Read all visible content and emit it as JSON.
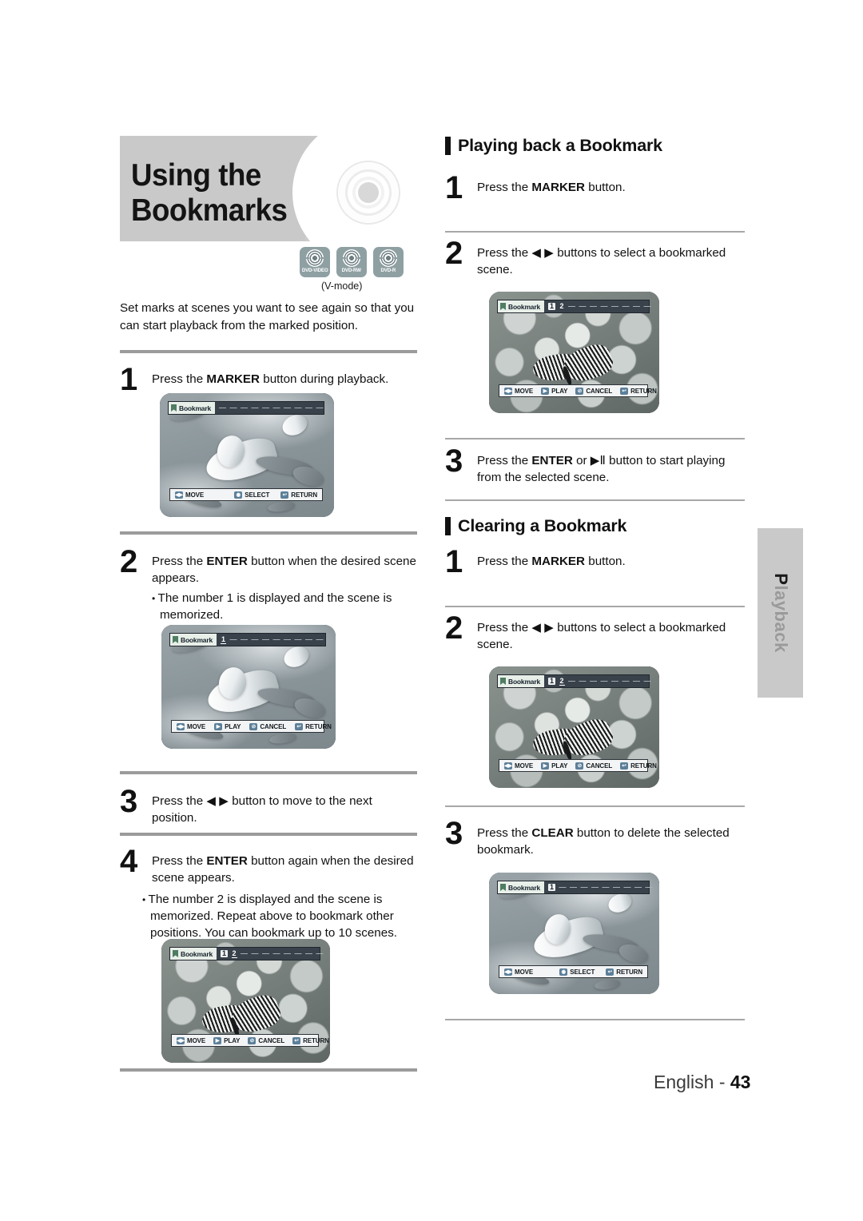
{
  "page": {
    "footer_prefix": "English - ",
    "footer_page": "43",
    "side_tab": "Playback",
    "side_tab_first": "P",
    "side_tab_rest": "layback"
  },
  "banner": {
    "title": "Using the Bookmarks",
    "disc_icon": "dvd-disc-graphic"
  },
  "disc_logos": [
    {
      "label": "DVD-VIDEO"
    },
    {
      "label": "DVD-RW"
    },
    {
      "label": "DVD-R"
    }
  ],
  "vmode_note": "(V-mode)",
  "intro": "Set marks at scenes you want to see again so that you can start playback from the marked position.",
  "left_steps": [
    {
      "num": "1",
      "text_parts": [
        "Press the ",
        "MARKER",
        " button during playback."
      ],
      "bullets": []
    },
    {
      "num": "2",
      "text_parts": [
        "Press the ",
        "ENTER",
        " button when the desired scene appears."
      ],
      "bullets": [
        "The number 1 is displayed and the scene is memorized."
      ]
    },
    {
      "num": "3",
      "text_parts": [
        "Press the ",
        "◀ ▶",
        " button to move to the next position."
      ],
      "bullets": []
    },
    {
      "num": "4",
      "text_parts": [
        "Press the ",
        "ENTER",
        " button again when the desired scene appears."
      ],
      "bullets": [
        "The number 2 is displayed and the scene is memorized. Repeat above to bookmark other positions. You can bookmark up to 10 scenes."
      ]
    }
  ],
  "right_sections": [
    {
      "title": "Playing back a Bookmark",
      "steps": [
        {
          "num": "1",
          "text_parts": [
            "Press the ",
            "MARKER",
            " button."
          ]
        },
        {
          "num": "2",
          "text_parts": [
            "Press the ",
            "◀ ▶",
            " buttons to select a bookmarked scene."
          ]
        },
        {
          "num": "3",
          "text_parts": [
            "Press the ",
            "ENTER",
            " or ▶Ⅱ  button to start playing from the selected scene."
          ]
        }
      ]
    },
    {
      "title": "Clearing a Bookmark",
      "steps": [
        {
          "num": "1",
          "text_parts": [
            "Press the ",
            "MARKER",
            " button."
          ]
        },
        {
          "num": "2",
          "text_parts": [
            "Press the ",
            "◀ ▶",
            " buttons to select a bookmarked scene."
          ]
        },
        {
          "num": "3",
          "text_parts": [
            "Press the ",
            "CLEAR",
            " button to delete the selected bookmark."
          ]
        }
      ]
    }
  ],
  "osd": {
    "tag_label": "Bookmark",
    "dash": "—",
    "screens": [
      {
        "id": "left-1",
        "scene": "gulls",
        "slots": [
          "",
          "",
          "",
          "",
          "",
          "",
          "",
          "",
          "",
          ""
        ],
        "buttons": [
          {
            "icon": "◀▶",
            "label": "MOVE"
          },
          {
            "icon": "◉",
            "label": "SELECT"
          },
          {
            "icon": "↩",
            "label": "RETURN"
          }
        ]
      },
      {
        "id": "left-2",
        "scene": "gulls",
        "slots": [
          "1",
          "",
          "",
          "",
          "",
          "",
          "",
          "",
          "",
          ""
        ],
        "buttons": [
          {
            "icon": "◀▶",
            "label": "MOVE"
          },
          {
            "icon": "▶",
            "label": "PLAY"
          },
          {
            "icon": "⊘",
            "label": "CANCEL"
          },
          {
            "icon": "↩",
            "label": "RETURN"
          }
        ]
      },
      {
        "id": "left-4",
        "scene": "flowers",
        "slots": [
          "1",
          "2",
          "",
          "",
          "",
          "",
          "",
          "",
          "",
          ""
        ],
        "buttons": [
          {
            "icon": "◀▶",
            "label": "MOVE"
          },
          {
            "icon": "▶",
            "label": "PLAY"
          },
          {
            "icon": "⊘",
            "label": "CANCEL"
          },
          {
            "icon": "↩",
            "label": "RETURN"
          }
        ]
      },
      {
        "id": "right-1",
        "scene": "flowers",
        "slots": [
          "1",
          "2",
          "",
          "",
          "",
          "",
          "",
          "",
          "",
          ""
        ],
        "buttons": [
          {
            "icon": "◀▶",
            "label": "MOVE"
          },
          {
            "icon": "▶",
            "label": "PLAY"
          },
          {
            "icon": "⊘",
            "label": "CANCEL"
          },
          {
            "icon": "↩",
            "label": "RETURN"
          }
        ]
      },
      {
        "id": "right-2",
        "scene": "flowers",
        "slots": [
          "1",
          "2",
          "",
          "",
          "",
          "",
          "",
          "",
          "",
          ""
        ],
        "buttons": [
          {
            "icon": "◀▶",
            "label": "MOVE"
          },
          {
            "icon": "▶",
            "label": "PLAY"
          },
          {
            "icon": "⊘",
            "label": "CANCEL"
          },
          {
            "icon": "↩",
            "label": "RETURN"
          }
        ]
      },
      {
        "id": "right-3",
        "scene": "gulls",
        "slots": [
          "1",
          "",
          "",
          "",
          "",
          "",
          "",
          "",
          "",
          ""
        ],
        "buttons": [
          {
            "icon": "◀▶",
            "label": "MOVE"
          },
          {
            "icon": "◉",
            "label": "SELECT"
          },
          {
            "icon": "↩",
            "label": "RETURN"
          }
        ]
      }
    ]
  },
  "colors": {
    "banner_bg": "#c9c9c9",
    "rule": "#9b9b9b",
    "logo_bg": "#8fa0a3",
    "osd_bar": "#39424b",
    "side_tab_bg": "#c9c9c9"
  }
}
